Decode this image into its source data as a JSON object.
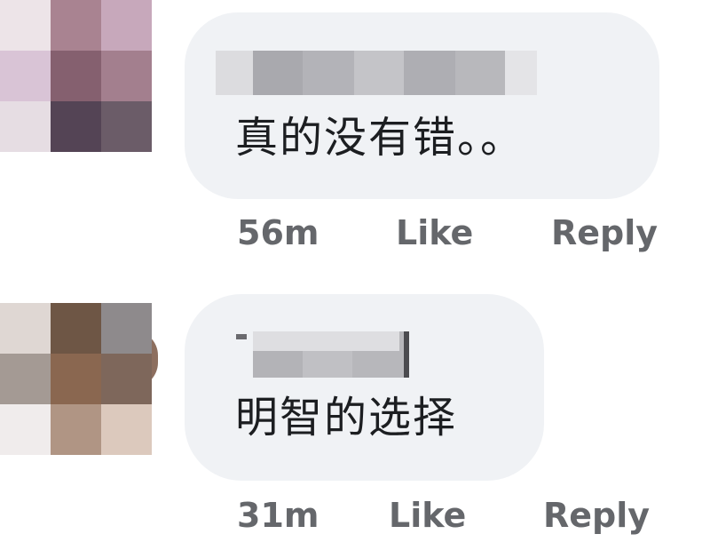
{
  "comments": [
    {
      "author_name": "",
      "text": "真的没有错。。",
      "time": "56m",
      "like_label": "Like",
      "reply_label": "Reply",
      "avatar_pixels": [
        "#ede4e8",
        "#a98391",
        "#c7a8bb",
        "#d9c4d6",
        "#85606f",
        "#a37f8e",
        "#e6dde3",
        "#544455",
        "#6b5c68"
      ]
    },
    {
      "author_name": "",
      "text": "明智的选择",
      "time": "31m",
      "like_label": "Like",
      "reply_label": "Reply",
      "avatar_pixels": [
        "#dfd7d3",
        "#6e5645",
        "#8e8a8c",
        "#a49a94",
        "#8a6750",
        "#7e675b",
        "#f0ecec",
        "#b09584",
        "#dcc9bd"
      ]
    }
  ],
  "colors": {
    "bubble_background": "#f0f2f5",
    "comment_text": "#1c1e21",
    "meta_text": "#65676b"
  }
}
